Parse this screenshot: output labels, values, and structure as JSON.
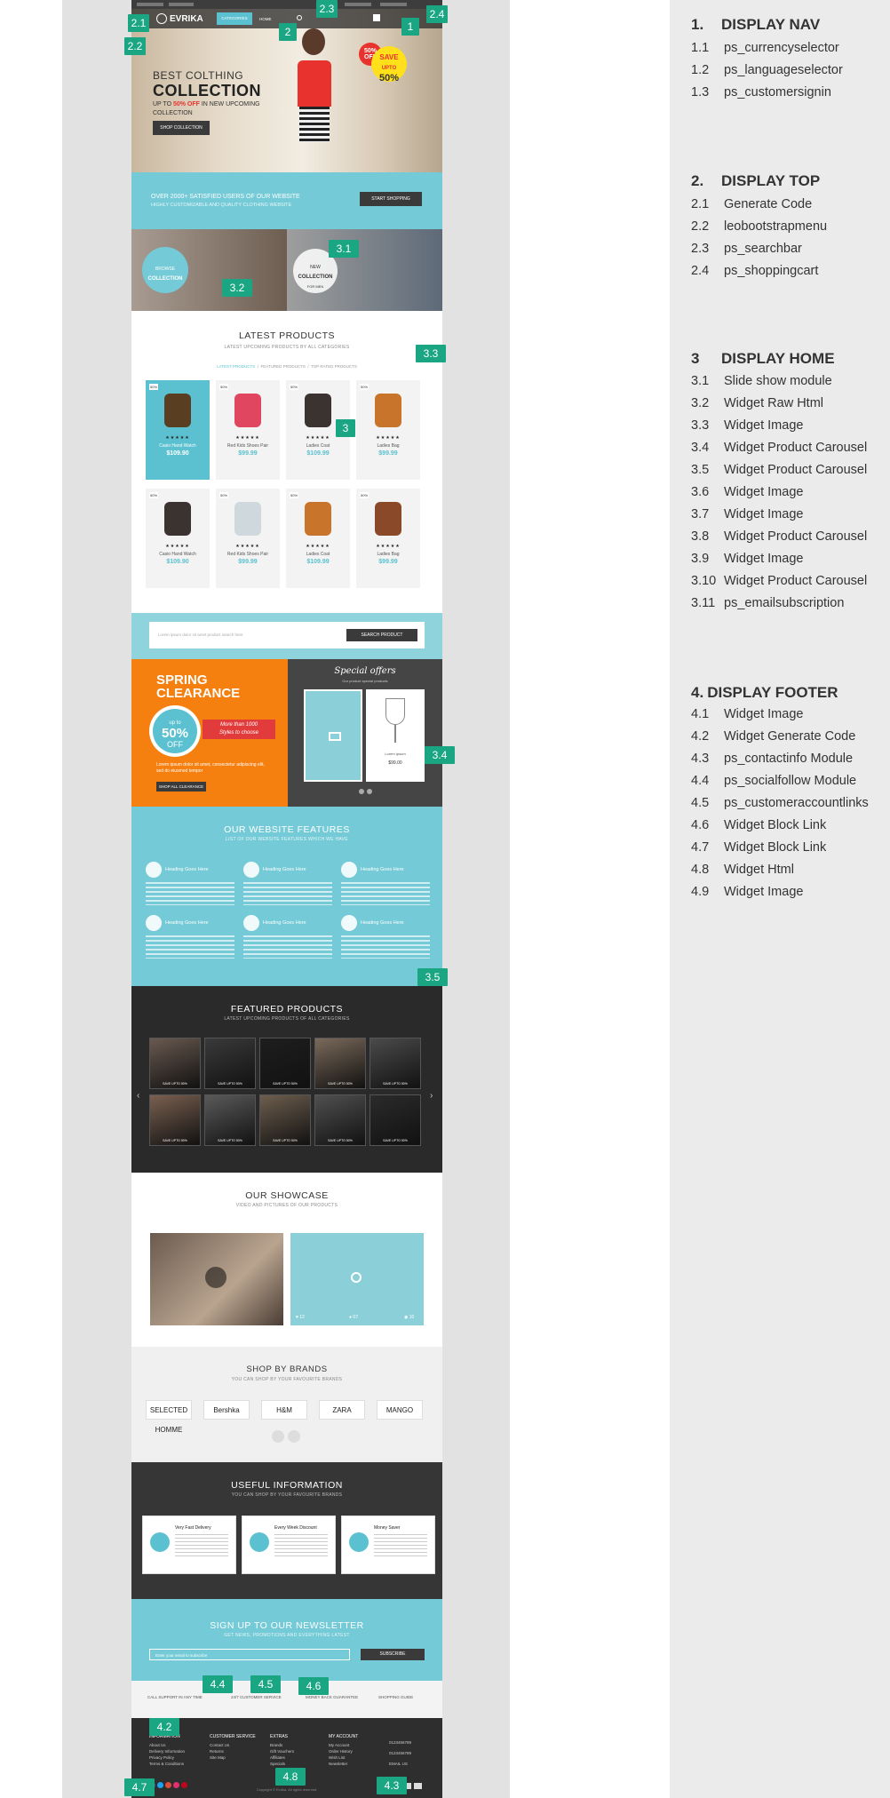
{
  "legend": {
    "sections": [
      {
        "num": "1.",
        "title": "DISPLAY NAV",
        "items": [
          {
            "num": "1.1",
            "label": "ps_currencyselector"
          },
          {
            "num": "1.2",
            "label": "ps_languageselector"
          },
          {
            "num": "1.3",
            "label": "ps_customersignin"
          }
        ]
      },
      {
        "num": "2.",
        "title": "DISPLAY TOP",
        "items": [
          {
            "num": "2.1",
            "label": "Generate Code"
          },
          {
            "num": "2.2",
            "label": "leobootstrapmenu"
          },
          {
            "num": "2.3",
            "label": "ps_searchbar"
          },
          {
            "num": "2.4",
            "label": "ps_shoppingcart"
          }
        ]
      },
      {
        "num": "3",
        "title": "DISPLAY HOME",
        "items": [
          {
            "num": "3.1",
            "label": "Slide show module"
          },
          {
            "num": "3.2",
            "label": "Widget Raw Html"
          },
          {
            "num": "3.3",
            "label": "Widget Image"
          },
          {
            "num": "3.4",
            "label": "Widget Product Carousel"
          },
          {
            "num": "3.5",
            "label": "Widget Product Carousel"
          },
          {
            "num": "3.6",
            "label": "Widget Image"
          },
          {
            "num": "3.7",
            "label": "Widget Image"
          },
          {
            "num": "3.8",
            "label": "Widget Product Carousel"
          },
          {
            "num": "3.9",
            "label": "Widget Image"
          },
          {
            "num": "3.10",
            "label": "Widget Product Carousel"
          },
          {
            "num": "3.11",
            "label": "ps_emailsubscription"
          }
        ]
      },
      {
        "num": "4.",
        "title": "DISPLAY FOOTER",
        "items": [
          {
            "num": "4.1",
            "label": "Widget Image"
          },
          {
            "num": "4.2",
            "label": "Widget Generate Code"
          },
          {
            "num": "4.3",
            "label": "ps_contactinfo Module"
          },
          {
            "num": "4.4",
            "label": "ps_socialfollow Module"
          },
          {
            "num": "4.5",
            "label": "ps_customeraccountlinks"
          },
          {
            "num": "4.6",
            "label": "Widget Block Link"
          },
          {
            "num": "4.7",
            "label": "Widget Block Link"
          },
          {
            "num": "4.8",
            "label": "Widget Html"
          },
          {
            "num": "4.9",
            "label": "Widget Image"
          }
        ]
      }
    ]
  },
  "markers": {
    "m2_1": "2.1",
    "m2_2": "2.2",
    "m2_3": "2.3",
    "m2_4": "2.4",
    "m1": "1",
    "m2": "2",
    "m3": "3",
    "m3_1": "3.1",
    "m3_2": "3.2",
    "m3_3": "3.3",
    "m3_4": "3.4",
    "m3_5": "3.5",
    "m4_2": "4.2",
    "m4_3": "4.3",
    "m4_4": "4.4",
    "m4_5": "4.5",
    "m4_6": "4.6",
    "m4_7": "4.7",
    "m4_8": "4.8"
  },
  "site": {
    "logo": "EVRIKA",
    "nav": [
      "CATEGORIES",
      "HOME"
    ],
    "hero": {
      "line1": "BEST COLTHING",
      "line2": "COLLECTION",
      "line3a": "UP TO ",
      "line3b": "50% OFF",
      "line3c": " IN NEW UPCOMING",
      "line4": "COLLECTION",
      "button": "SHOP COLLECTION",
      "badge1a": "50%",
      "badge1b": "OFF",
      "badge2a": "SAVE",
      "badge2b": "UPTO",
      "badge2c": "50%"
    },
    "promo": {
      "line1": "OVER 2000+ SATISFIED USERS OF OUR WEBSITE",
      "line2": "HIGHLY CUSTOMIZABLE AND QUALITY CLOTHING WEBSITE",
      "button": "START SHOPPING"
    },
    "browse": {
      "line1": "BROWSE",
      "line2": "COLLECTION"
    },
    "newcoll": {
      "line1": "NEW",
      "line2": "COLLECTION",
      "line3": "FOR MEN"
    },
    "latest": {
      "title": "LATEST PRODUCTS",
      "sub": "LATEST UPCOMING PRODUCTS BY ALL CATEGORIES",
      "tabs": [
        "LATEST PRODUCTS",
        "FEATURED PRODUCTS",
        "TOP RATED PRODUCTS"
      ],
      "products": [
        {
          "name": "Casio Hand Watch",
          "price": "$109.90",
          "icon": "watch-icon"
        },
        {
          "name": "Red Kids Shoes Pair",
          "price": "$99.99",
          "icon": "shoe-icon"
        },
        {
          "name": "Ladies Coat",
          "price": "$109.99",
          "icon": "coat-icon"
        },
        {
          "name": "Ladies Bag",
          "price": "$99.99",
          "icon": "bag-icon"
        },
        {
          "name": "Casio Hand Watch",
          "price": "$109.90",
          "icon": "coat-icon"
        },
        {
          "name": "Red Kids Shoes Pair",
          "price": "$99.99",
          "icon": "glass-icon"
        },
        {
          "name": "Ladies Coat",
          "price": "$109.99",
          "icon": "bag-icon"
        },
        {
          "name": "Ladies Bag",
          "price": "$99.99",
          "icon": "heel-icon"
        }
      ],
      "stars": "★★★★★"
    },
    "search": {
      "placeholder": "Lorem ipsum dolor sit amet product search here",
      "button": "SEARCH PRODUCT"
    },
    "spring": {
      "line1": "SPRING",
      "line2": "CLEARANCE",
      "upto": "up to",
      "pct": "50%",
      "off": "OFF",
      "ribbon1": "More than 1000",
      "ribbon2": "Styles to choose",
      "text": "Lorem ipsum dolor sit amet, consectetur adipiscing elit, sed do eiusmod tempor",
      "button": "SHOP ALL CLEARANCE"
    },
    "special": {
      "title": "Special offers",
      "sub": "Our product special products",
      "pname": "Lorem Ipsum",
      "price": "$99.00"
    },
    "features": {
      "title": "OUR WEBSITE FEATURES",
      "sub": "LIST OF OUR WEBSITE FEATURES WHICH WE HAVE",
      "heading": "Heading Goes Here"
    },
    "featured": {
      "title": "FEATURED PRODUCTS",
      "sub": "LATEST UPCOMING PRODUCTS OF ALL CATEGORIES",
      "tag": "SAVE UPTO 50%"
    },
    "showcase": {
      "title": "OUR SHOWCASE",
      "sub": "VIDEO AND PICTURES OF OUR PRODUCTS",
      "likes": "12",
      "comments": "07",
      "views": "10"
    },
    "brands": {
      "title": "SHOP BY BRANDS",
      "sub": "YOU CAN SHOP BY YOUR FAVOURITE BRANDS",
      "list": [
        "SELECTED HOMME",
        "Bershka",
        "H&M",
        "ZARA",
        "MANGO"
      ]
    },
    "useful": {
      "title": "USEFUL INFORMATION",
      "sub": "YOU CAN SHOP BY YOUR FAVOURITE BRANDS",
      "items": [
        "Very Fast Delivery",
        "Every Week Discount",
        "Money Saver"
      ]
    },
    "newsletter": {
      "title": "SIGN UP TO OUR NEWSLETTER",
      "sub": "GET NEWS, PROMOTIONS AND EVERYTHING LATEST",
      "placeholder": "Enter your email to subscribe",
      "button": "SUBSCRIBE"
    },
    "services": [
      "CALL SUPPORT IN ANY TIME",
      "24/7 CUSTOMER SERVICE",
      "MONEY BACK GUARANTEE",
      "SHOPPING GUIDE"
    ],
    "footer": {
      "cols": [
        {
          "h": "INFORMATION",
          "links": [
            "About Us",
            "Delivery Information",
            "Privacy Policy",
            "Terms & Conditions"
          ]
        },
        {
          "h": "CUSTOMER SERVICE",
          "links": [
            "Contact Us",
            "Returns",
            "Site Map"
          ]
        },
        {
          "h": "EXTRAS",
          "links": [
            "Brands",
            "Gift Vouchers",
            "Affiliates",
            "Specials"
          ]
        },
        {
          "h": "MY ACCOUNT",
          "links": [
            "My Account",
            "Order History",
            "Wish List",
            "Newsletter"
          ]
        }
      ],
      "contact": [
        "0123456789",
        "0123456789",
        "EMAIL US"
      ],
      "copyright": "Copyright © Evrika. All rights reserved."
    }
  }
}
